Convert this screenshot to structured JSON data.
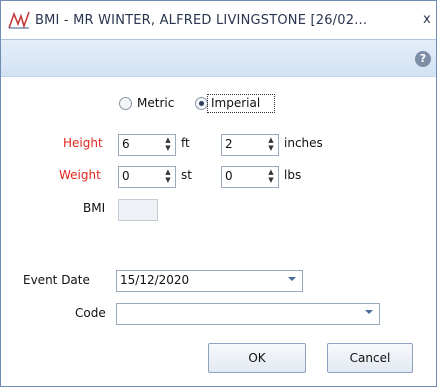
{
  "window": {
    "title": "BMI - MR WINTER, ALFRED LIVINGSTONE [26/02...",
    "close_label": "x"
  },
  "help": {
    "label": "?"
  },
  "units": {
    "metric_label": "Metric",
    "imperial_label": "Imperial",
    "selected": "Imperial"
  },
  "height": {
    "label": "Height",
    "ft_value": "6",
    "ft_unit": "ft",
    "inches_value": "2",
    "inches_unit": "inches"
  },
  "weight": {
    "label": "Weight",
    "st_value": "0",
    "st_unit": "st",
    "lbs_value": "0",
    "lbs_unit": "lbs"
  },
  "bmi": {
    "label": "BMI",
    "value": ""
  },
  "event_date": {
    "label": "Event Date",
    "value": "15/12/2020"
  },
  "code": {
    "label": "Code",
    "value": ""
  },
  "buttons": {
    "ok": "OK",
    "cancel": "Cancel"
  },
  "colors": {
    "required_label": "#e0261e",
    "help_bar": "#dbe7f6"
  }
}
